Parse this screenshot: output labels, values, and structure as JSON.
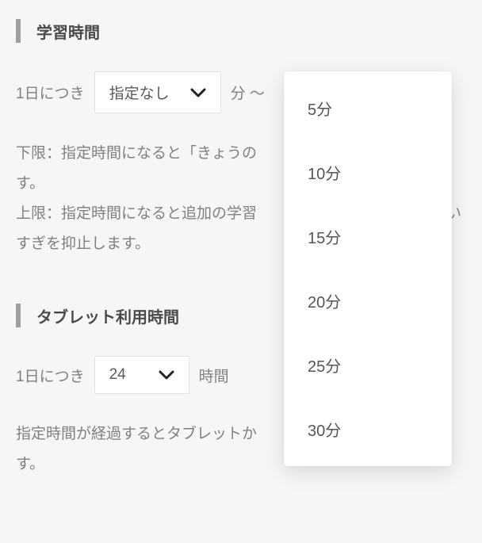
{
  "section1": {
    "title": "学習時間",
    "row_prefix": "1日につき",
    "select_value": "指定なし",
    "unit_suffix": "分 〜",
    "desc_line1": "下限：指定時間になると「きょうの",
    "desc_line2": "す。",
    "desc_line3": "上限：指定時間になると追加の学習",
    "desc_line3_tail": "い",
    "desc_line4": "すぎを抑止します。"
  },
  "section2": {
    "title": "タブレット利用時間",
    "row_prefix": "1日につき",
    "select_value": "24",
    "unit_suffix": "時間",
    "desc_line1": "指定時間が経過するとタブレットか",
    "desc_line2": "す。"
  },
  "dropdown": {
    "options": [
      "5分",
      "10分",
      "15分",
      "20分",
      "25分",
      "30分"
    ]
  }
}
